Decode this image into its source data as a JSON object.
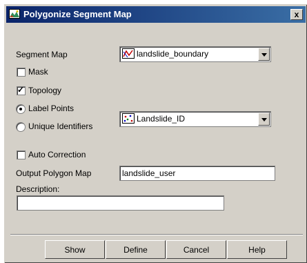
{
  "window": {
    "title": "Polygonize Segment Map",
    "close_label": "x"
  },
  "form": {
    "segment_map_label": "Segment Map",
    "segment_map_value": "landslide_boundary",
    "mask_label": "Mask",
    "mask_checked": false,
    "topology_label": "Topology",
    "topology_checked": true,
    "label_points_label": "Label Points",
    "label_points_selected": true,
    "label_points_value": "Landslide_ID",
    "unique_identifiers_label": "Unique Identifiers",
    "unique_identifiers_selected": false,
    "auto_correction_label": "Auto Correction",
    "auto_correction_checked": false,
    "output_polygon_map_label": "Output Polygon Map",
    "output_polygon_map_value": "landslide_user",
    "description_label": "Description:",
    "description_value": ""
  },
  "buttons": {
    "show": "Show",
    "define": "Define",
    "cancel": "Cancel",
    "help": "Help"
  },
  "icons": {
    "title_icon": "map-icon",
    "segment_map_icon": "segment-map-icon",
    "point_map_icon": "point-map-icon"
  }
}
